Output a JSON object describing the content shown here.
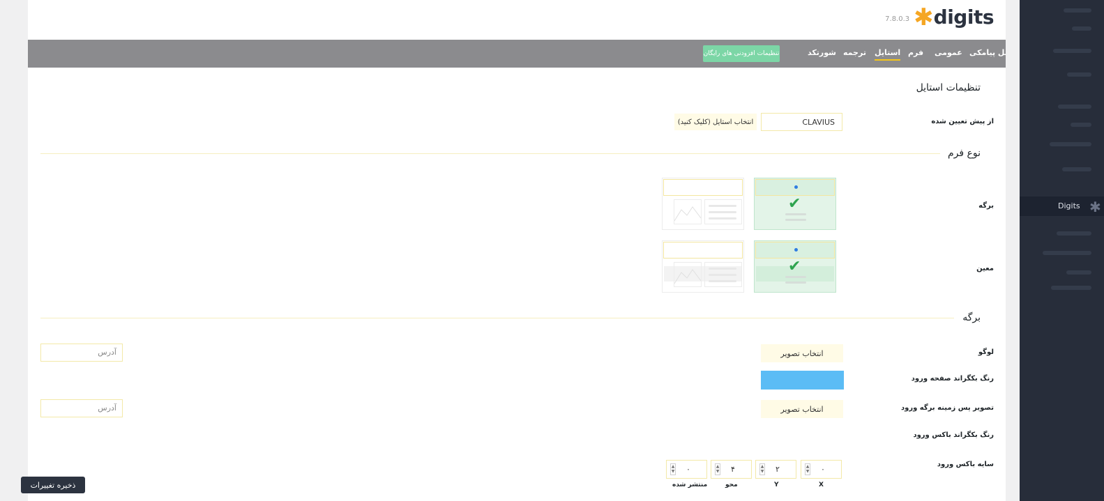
{
  "brand": {
    "version": "7.8.0.3",
    "name": "digits"
  },
  "nav": {
    "tabs": [
      {
        "label": "پنل پیامکی",
        "active": false
      },
      {
        "label": "عمومی",
        "active": false
      },
      {
        "label": "فرم",
        "active": false
      },
      {
        "label": "استایل",
        "active": true
      },
      {
        "label": "ترجمه",
        "active": false
      },
      {
        "label": "شورتکد",
        "active": false
      }
    ],
    "free_addons_label": "تنظیمات افزودنی های رایگان"
  },
  "style_settings": {
    "title": "تنظیمات استایل",
    "preset_label": "از پیش تعیین شده",
    "preset_value": "CLAVIUS",
    "preset_hint": "انتخاب استایل (کلیک کنید)"
  },
  "form_type": {
    "title": "نوع فرم",
    "rows": [
      {
        "label": "برگه"
      },
      {
        "label": "معین"
      }
    ]
  },
  "page_section": {
    "title": "برگه",
    "logo_label": "لوگو",
    "logo_button": "انتخاب تصویر",
    "logo_address_placeholder": "آدرس",
    "bg_color_label": "رنگ بکگراند صفحه ورود",
    "bg_color_value": "#5bbcf5",
    "bg_image_label": "تصویر پس زمینه برگه ورود",
    "bg_image_button": "انتخاب تصویر",
    "bg_image_address_placeholder": "آدرس",
    "box_bg_color_label": "رنگ بکگراند باکس ورود",
    "box_shadow_label": "سایه باکس ورود",
    "shadow": [
      {
        "label": "X",
        "value": "۰"
      },
      {
        "label": "Y",
        "value": "۲"
      },
      {
        "label": "محو",
        "value": "۴"
      },
      {
        "label": "منتشر شده",
        "value": "۰"
      }
    ]
  },
  "save_button": "ذخیره تغییرات",
  "sidebar": {
    "active_item": "Digits"
  },
  "colors": {
    "accent": "#f5c518",
    "nav_bg": "#8b8b8e",
    "sidebar_bg": "#272d3a",
    "free_btn": "#7cd6a6"
  }
}
